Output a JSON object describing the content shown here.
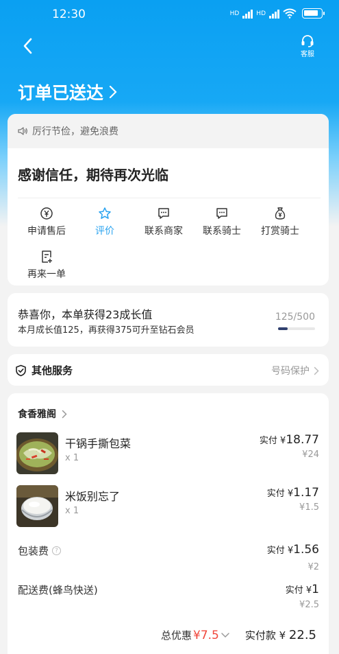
{
  "status": {
    "time": "12:30",
    "net1": "HD",
    "net2": "HD"
  },
  "header": {
    "customer_service": "客服",
    "order_title": "订单已送达"
  },
  "notice": {
    "text": "厉行节俭，避免浪费"
  },
  "thanks": "感谢信任，期待再次光临",
  "actions": [
    {
      "label": "申请售后",
      "icon": "yuan-circle-icon"
    },
    {
      "label": "评价",
      "icon": "star-icon",
      "highlighted": true
    },
    {
      "label": "联系商家",
      "icon": "chat-icon"
    },
    {
      "label": "联系骑士",
      "icon": "chat-icon"
    },
    {
      "label": "打赏骑士",
      "icon": "money-bag-icon"
    },
    {
      "label": "再来一单",
      "icon": "reorder-icon"
    }
  ],
  "growth": {
    "title": "恭喜你，本单获得23成长值",
    "subtitle": "本月成长值125，再获得375可升至钻石会员",
    "progress_text": "125/500",
    "progress": 0.25
  },
  "services": {
    "label": "其他服务",
    "right": "号码保护"
  },
  "order": {
    "shop": "食香雅阁",
    "items": [
      {
        "name": "干锅手撕包菜",
        "qty": "x 1",
        "paid_prefix": "实付 ¥",
        "paid": "18.77",
        "original": "¥24"
      },
      {
        "name": "米饭别忘了",
        "qty": "x 1",
        "paid_prefix": "实付 ¥",
        "paid": "1.17",
        "original": "¥1.5"
      }
    ],
    "fees": [
      {
        "label": "包装费",
        "paid_prefix": "实付 ¥",
        "paid": "1.56",
        "original": "¥2"
      },
      {
        "label": "配送费(蜂鸟快送)",
        "paid_prefix": "实付 ¥",
        "paid": "1",
        "original": "¥2.5"
      }
    ],
    "total_discount_label": "总优惠",
    "total_discount_value": "¥7.5",
    "total_paid_label": "实付款 ¥",
    "total_paid_value": "22.5"
  },
  "colors": {
    "header_blue": "#0aa0f2",
    "highlight": "#2aa3ef",
    "discount_red": "#f0473c"
  }
}
